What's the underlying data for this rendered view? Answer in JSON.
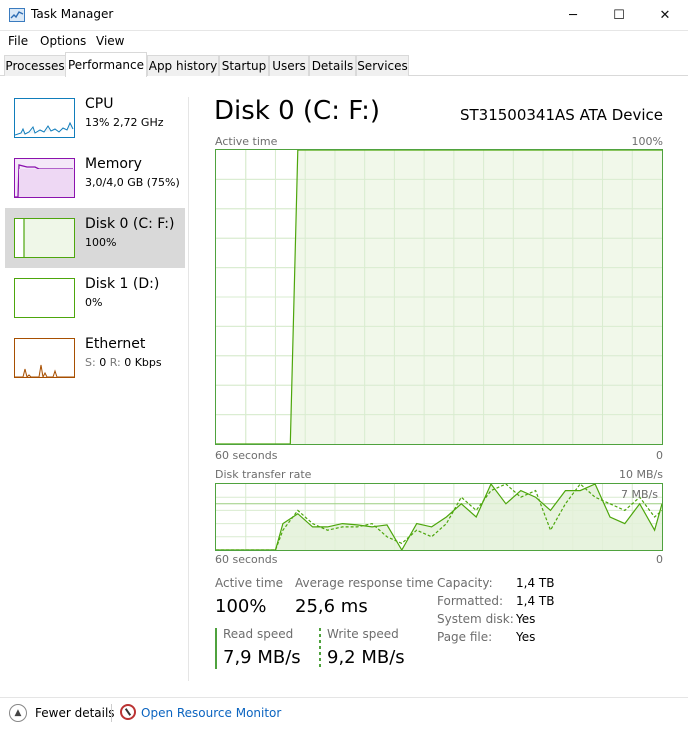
{
  "window": {
    "title": "Task Manager",
    "controls": {
      "minimize": "─",
      "maximize": "☐",
      "close": "✕"
    }
  },
  "menu": [
    "File",
    "Options",
    "View"
  ],
  "tabs": [
    "Processes",
    "Performance",
    "App history",
    "Startup",
    "Users",
    "Details",
    "Services"
  ],
  "active_tab": "Performance",
  "sidebar": [
    {
      "name": "CPU",
      "sub": "13%  2,72 GHz",
      "color": "#117dbb",
      "fill": "#f1f6fa"
    },
    {
      "name": "Memory",
      "sub": "3,0/4,0 GB (75%)",
      "color": "#8b12ae",
      "fill": "#f4e8f8"
    },
    {
      "name": "Disk 0 (C: F:)",
      "sub": "100%",
      "color": "#4da60c",
      "fill": "#eff7e8"
    },
    {
      "name": "Disk 1 (D:)",
      "sub": "0%",
      "color": "#4da60c",
      "fill": "#ffffff"
    },
    {
      "name": "Ethernet",
      "sub_s_label": "S:",
      "sub_s_value": "0",
      "sub_r_label": "R:",
      "sub_r_value": "0 Kbps",
      "color": "#a74f01",
      "fill": "#fcf3eb"
    }
  ],
  "selected_index": 2,
  "main": {
    "title": "Disk 0 (C: F:)",
    "device": "ST31500341AS ATA Device",
    "active_chart": {
      "label": "Active time",
      "max_label": "100%",
      "time_label": "60 seconds",
      "min_label": "0"
    },
    "transfer_chart": {
      "label": "Disk transfer rate",
      "max_label": "10 MB/s",
      "marker_label": "7 MB/s",
      "time_label": "60 seconds",
      "min_label": "0"
    },
    "stats": {
      "active_time_label": "Active time",
      "active_time_value": "100%",
      "avg_resp_label": "Average response time",
      "avg_resp_value": "25,6 ms",
      "read_label": "Read speed",
      "read_value": "7,9 MB/s",
      "write_label": "Write speed",
      "write_value": "9,2 MB/s"
    },
    "properties": [
      {
        "label": "Capacity:",
        "value": "1,4 TB"
      },
      {
        "label": "Formatted:",
        "value": "1,4 TB"
      },
      {
        "label": "System disk:",
        "value": "Yes"
      },
      {
        "label": "Page file:",
        "value": "Yes"
      }
    ]
  },
  "footer": {
    "fewer_details": "Fewer details",
    "open_resource_monitor": "Open Resource Monitor"
  },
  "chart_data": [
    {
      "type": "area",
      "label": "Active time",
      "ylim": [
        0,
        100
      ],
      "x": [
        60,
        59,
        58,
        57,
        56,
        55,
        54,
        53,
        52,
        51,
        50,
        49,
        48,
        47,
        46,
        45,
        44,
        43,
        42,
        41,
        40,
        35,
        30,
        25,
        20,
        15,
        10,
        5,
        0
      ],
      "values": [
        0,
        0,
        0,
        0,
        0,
        0,
        0,
        0,
        0,
        0,
        0,
        100,
        100,
        100,
        100,
        100,
        100,
        100,
        100,
        100,
        100,
        100,
        100,
        100,
        100,
        100,
        100,
        100,
        100
      ]
    },
    {
      "type": "line",
      "label": "Disk transfer rate",
      "ylim": [
        0,
        10
      ],
      "x": [
        60,
        57.5,
        55,
        53,
        52,
        51,
        49,
        47,
        45,
        43,
        41,
        39,
        37,
        35,
        33,
        31,
        29,
        27,
        25,
        23,
        21,
        19,
        17,
        15,
        13,
        11,
        9,
        7,
        5,
        3,
        1,
        0
      ],
      "series": [
        {
          "name": "read",
          "values": [
            0,
            0,
            0,
            0,
            0,
            4,
            5.5,
            3.5,
            3.5,
            4,
            3.8,
            3.5,
            3.8,
            0,
            4,
            3.5,
            5,
            7,
            5,
            10,
            7,
            9,
            8,
            6,
            9,
            9,
            10,
            5,
            4,
            7,
            3,
            7
          ]
        },
        {
          "name": "write",
          "values": [
            0,
            0,
            0,
            0,
            0,
            3,
            6,
            4,
            3,
            3.5,
            3.5,
            4,
            2,
            1,
            3,
            2,
            4,
            8,
            6,
            9,
            10,
            8,
            9,
            3,
            7,
            10,
            8,
            7,
            6,
            8,
            5,
            6
          ]
        }
      ]
    }
  ]
}
